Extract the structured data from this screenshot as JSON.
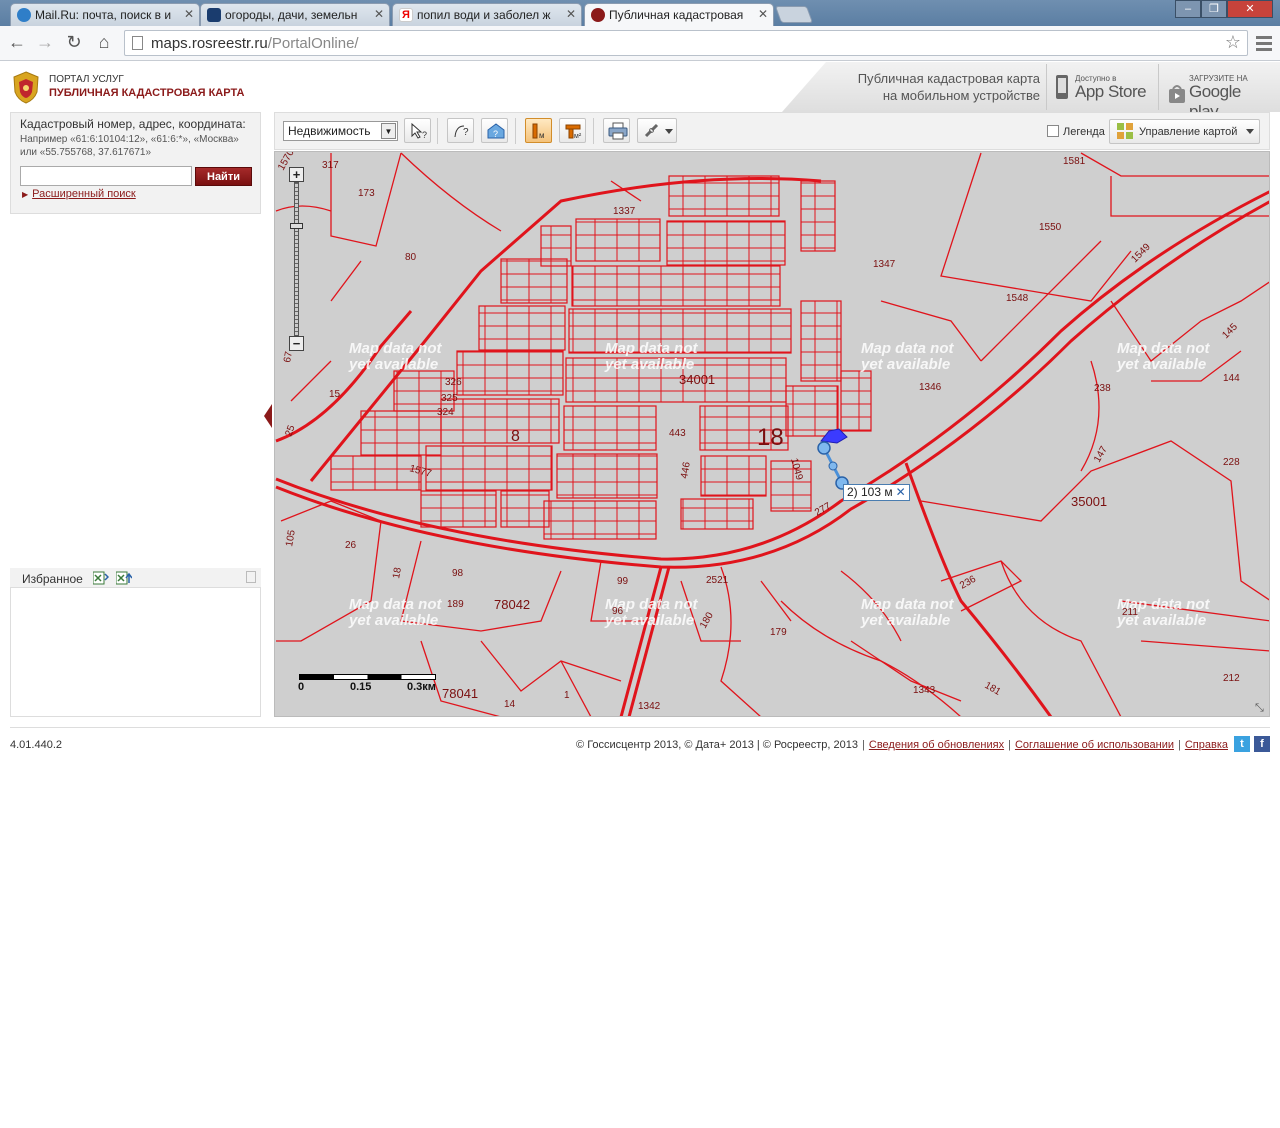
{
  "browser": {
    "tabs": [
      {
        "label": "Mail.Ru: почта, поиск в и",
        "active": false
      },
      {
        "label": "огороды, дачи, земельн",
        "active": false
      },
      {
        "label": "попил води и заболел ж",
        "active": false
      },
      {
        "label": "Публичная кадастровая",
        "active": true
      }
    ],
    "url_host": "maps.rosreestr.ru",
    "url_path": "/PortalOnline/"
  },
  "header": {
    "portal_small": "ПОРТАЛ УСЛУГ",
    "portal_title": "ПУБЛИЧНАЯ КАДАСТРОВАЯ КАРТА",
    "mobile_line1": "Публичная кадастровая карта",
    "mobile_line2": "на мобильном устройстве",
    "appstore_small": "Доступно в",
    "appstore_big": "App Store",
    "googleplay_small": "ЗАГРУЗИТЕ НА",
    "googleplay_big": "Google play"
  },
  "search": {
    "label": "Кадастровый номер, адрес, координата:",
    "example": "Например «61:6:10104:12», «61:6:*», «Москва» или «55.755768, 37.617671»",
    "value": "",
    "button": "Найти",
    "advanced": "Расширенный поиск"
  },
  "favorites": {
    "title": "Избранное"
  },
  "map_toolbar": {
    "layer_select": "Недвижимость",
    "legend_label": "Легенда",
    "legend_checked": false,
    "map_control": "Управление картой"
  },
  "map": {
    "measure_label": "2) 103 м",
    "no_data_line1": "Map data not",
    "no_data_line2": "yet available",
    "parcel_labels": {
      "p1570": "1570",
      "p317": "317",
      "p173": "173",
      "p80": "80",
      "p1337": "1337",
      "p1581": "1581",
      "p1550": "1550",
      "p1549": "1549",
      "p1347": "1347",
      "p1548": "1548",
      "p145": "145",
      "p144": "144",
      "p238": "238",
      "p1346": "1346",
      "p34001": "34001",
      "p326": "326",
      "p325": "325",
      "p324": "324",
      "p15": "15",
      "p67": "67",
      "p25": "25",
      "p8": "8",
      "p443": "443",
      "p18": "18",
      "p1049": "1049",
      "p446": "446",
      "p1577": "1577",
      "p147": "147",
      "p228": "228",
      "p35001": "35001",
      "p277": "277",
      "p105": "105",
      "p26": "26",
      "p18b": "18",
      "p98": "98",
      "p99": "99",
      "p2521": "2521",
      "p189": "189",
      "p78042": "78042",
      "p96": "96",
      "p180": "180",
      "p179": "179",
      "p236": "236",
      "p211": "211",
      "p212": "212",
      "p1343": "1343",
      "p181": "181",
      "p78041": "78041",
      "p14": "14",
      "p1": "1",
      "p1342": "1342"
    },
    "scale": {
      "s0": "0",
      "s1": "0.15",
      "s2": "0.3км"
    }
  },
  "footer": {
    "version": "4.01.440.2",
    "copyright": "© Госсисцентр 2013, © Дата+ 2013 | © Росреестр, 2013",
    "links": [
      "Сведения об обновлениях",
      "Соглашение об использовании",
      "Справка"
    ]
  },
  "colors": {
    "brand": "#8b1a1a",
    "parcel_line": "#e0141c",
    "map_bg": "#cfcfcf"
  }
}
